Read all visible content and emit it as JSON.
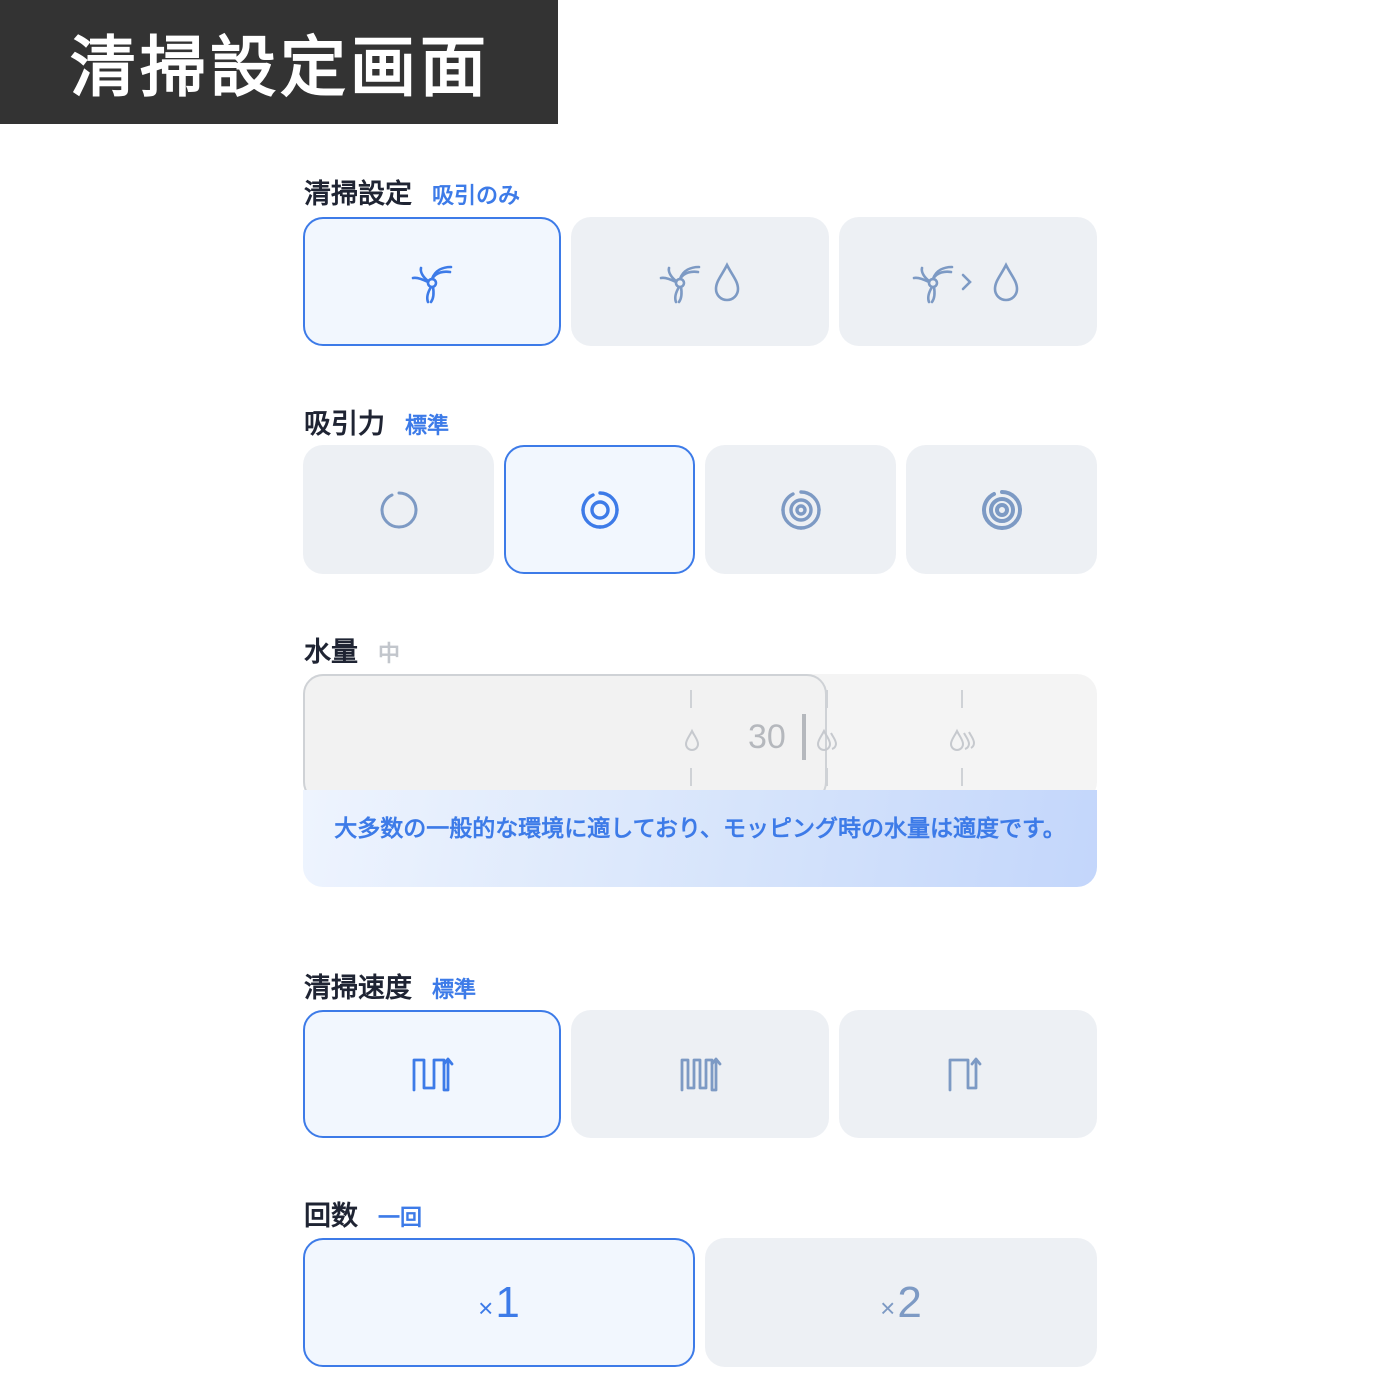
{
  "banner_title": "清掃設定画面",
  "accent_color": "#3d7be8",
  "cleaning_mode": {
    "label": "清掃設定",
    "value": "吸引のみ",
    "options": [
      {
        "icon": "fan-icon",
        "selected": true
      },
      {
        "icon": "fan-and-water-drop-icon",
        "selected": false
      },
      {
        "icon": "fan-then-water-drop-icon",
        "selected": false
      }
    ]
  },
  "suction_power": {
    "label": "吸引力",
    "value": "標準",
    "options": [
      {
        "icon": "suction-level-1-icon",
        "selected": false
      },
      {
        "icon": "suction-level-2-icon",
        "selected": true
      },
      {
        "icon": "suction-level-3-icon",
        "selected": false
      },
      {
        "icon": "suction-level-4-icon",
        "selected": false
      }
    ]
  },
  "water_amount": {
    "label": "水量",
    "value": "中",
    "slider_readout": "30",
    "description": "大多数の一般的な環境に適しており、モッピング時の水量は適度です。"
  },
  "cleaning_speed": {
    "label": "清掃速度",
    "value": "標準",
    "options": [
      {
        "icon": "standard-path-icon",
        "selected": true
      },
      {
        "icon": "dense-path-icon",
        "selected": false
      },
      {
        "icon": "quick-path-icon",
        "selected": false
      }
    ]
  },
  "passes": {
    "label": "回数",
    "value": "一回",
    "options": [
      {
        "symbol": "×",
        "count": "1",
        "selected": true
      },
      {
        "symbol": "×",
        "count": "2",
        "selected": false
      }
    ]
  }
}
